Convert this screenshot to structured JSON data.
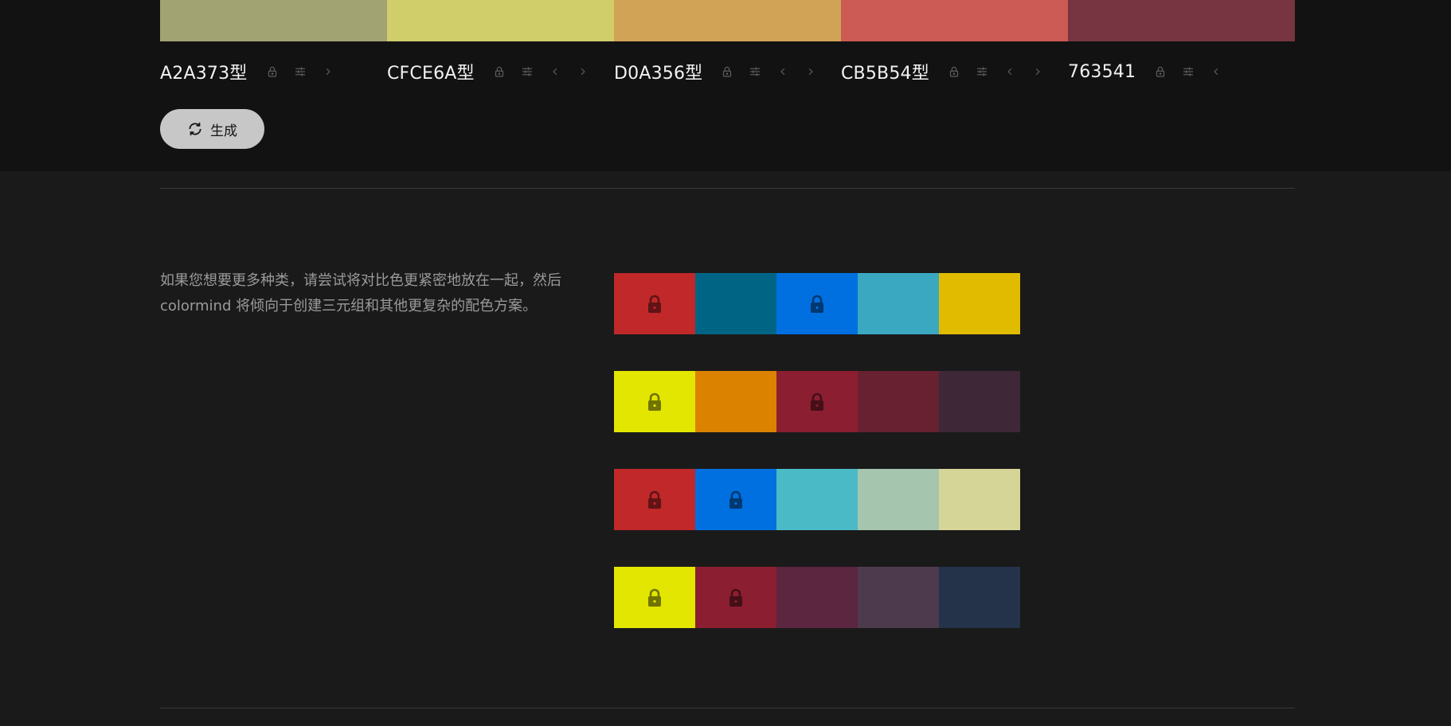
{
  "palette": {
    "swatches": [
      "#A2A373",
      "#CFCE6A",
      "#D0A356",
      "#CB5B54",
      "#763541"
    ],
    "labels": [
      "A2A373型",
      "CFCE6A型",
      "D0A356型",
      "CB5B54型",
      "763541"
    ],
    "controls": [
      {
        "lock": true,
        "adjust": true,
        "left": false,
        "right": true
      },
      {
        "lock": true,
        "adjust": true,
        "left": true,
        "right": true
      },
      {
        "lock": true,
        "adjust": true,
        "left": true,
        "right": true
      },
      {
        "lock": true,
        "adjust": true,
        "left": true,
        "right": true
      },
      {
        "lock": true,
        "adjust": true,
        "left": true,
        "right": false
      }
    ],
    "icons": {
      "lock": "lock-open-icon",
      "adjust": "sliders-icon",
      "left": "chevron-left-icon",
      "right": "chevron-right-icon"
    }
  },
  "generate": {
    "label": "生成",
    "icon": "refresh-icon"
  },
  "tip": {
    "text": "如果您想要更多种类，请尝试将对比色更紧密地放在一起，然后 colormind 将倾向于创建三元组和其他更复杂的配色方案。"
  },
  "examples": [
    {
      "colors": [
        "#C0282A",
        "#006585",
        "#0070E0",
        "#3AA8C1",
        "#E0BB00"
      ],
      "locked": [
        true,
        false,
        true,
        false,
        false
      ]
    },
    {
      "colors": [
        "#E2E600",
        "#DB8200",
        "#8B1E30",
        "#672130",
        "#3E2838"
      ],
      "locked": [
        true,
        false,
        true,
        false,
        false
      ]
    },
    {
      "colors": [
        "#C0282A",
        "#0070E0",
        "#4ABAC6",
        "#A6C5AE",
        "#D6D598"
      ],
      "locked": [
        true,
        true,
        false,
        false,
        false
      ]
    },
    {
      "colors": [
        "#E2E600",
        "#8B1E30",
        "#5C2540",
        "#4E3A4D",
        "#243349"
      ],
      "locked": [
        true,
        true,
        false,
        false,
        false
      ]
    }
  ]
}
